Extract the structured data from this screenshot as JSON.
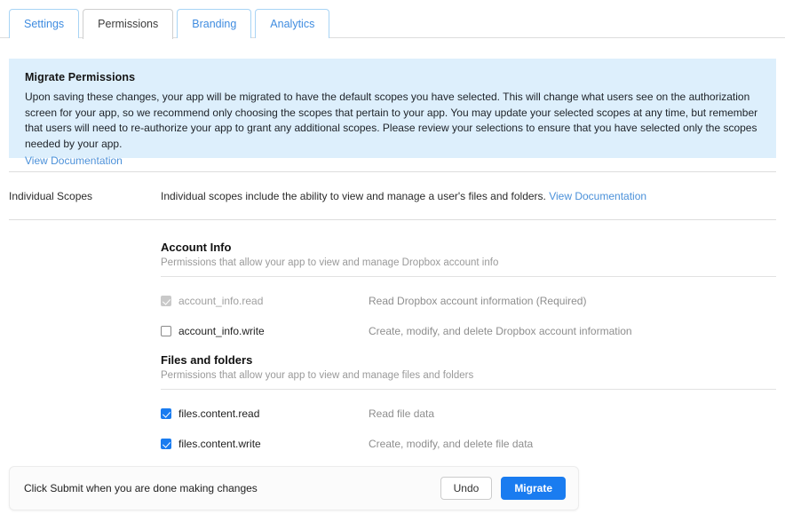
{
  "tabs": [
    {
      "label": "Settings",
      "active": false
    },
    {
      "label": "Permissions",
      "active": true
    },
    {
      "label": "Branding",
      "active": false
    },
    {
      "label": "Analytics",
      "active": false
    }
  ],
  "banner": {
    "title": "Migrate Permissions",
    "body": "Upon saving these changes, your app will be migrated to have the default scopes you have selected. This will change what users see on the authorization screen for your app, so we recommend only choosing the scopes that pertain to your app. You may update your selected scopes at any time, but remember that users will need to re-authorize your app to grant any additional scopes. Please review your selections to ensure that you have selected only the scopes needed by your app.",
    "link": "View Documentation",
    "background_color": "#ddeffc"
  },
  "individual_scopes": {
    "label": "Individual Scopes",
    "description": "Individual scopes include the ability to view and manage a user's files and folders.",
    "link": "View Documentation"
  },
  "groups": [
    {
      "title": "Account Info",
      "subtitle": "Permissions that allow your app to view and manage Dropbox account info",
      "items": [
        {
          "name": "account_info.read",
          "description": "Read Dropbox account information (Required)",
          "state": "checked-disabled"
        },
        {
          "name": "account_info.write",
          "description": "Create, modify, and delete Dropbox account information",
          "state": "empty"
        }
      ]
    },
    {
      "title": "Files and folders",
      "subtitle": "Permissions that allow your app to view and manage files and folders",
      "items": [
        {
          "name": "files.content.read",
          "description": "Read file data",
          "state": "checked"
        },
        {
          "name": "files.content.write",
          "description": "Create, modify, and delete file data",
          "state": "checked"
        }
      ]
    }
  ],
  "action_bar": {
    "message": "Click Submit when you are done making changes",
    "undo_label": "Undo",
    "migrate_label": "Migrate",
    "accent_color": "#1a7cf0"
  }
}
